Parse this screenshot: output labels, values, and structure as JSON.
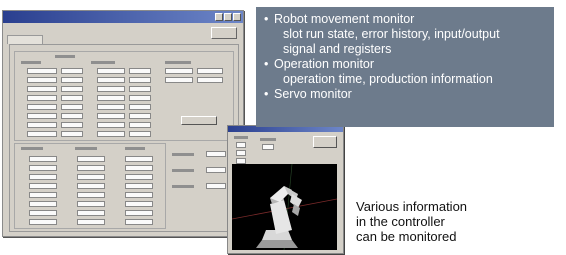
{
  "callout": {
    "items": [
      {
        "title": "Robot movement monitor",
        "details": [
          "slot run state, error history, input/output",
          "signal and registers"
        ]
      },
      {
        "title": "Operation monitor",
        "details": [
          "operation time, production information"
        ]
      },
      {
        "title": "Servo monitor",
        "details": []
      }
    ]
  },
  "caption": {
    "lines": [
      "Various information",
      "in the controller",
      "can be monitored"
    ]
  },
  "colors": {
    "callout_bg": "#6d7b8c",
    "window_face": "#d4d0c8",
    "titlebar": "#2a3f8f",
    "viewport_bg": "#000000"
  }
}
